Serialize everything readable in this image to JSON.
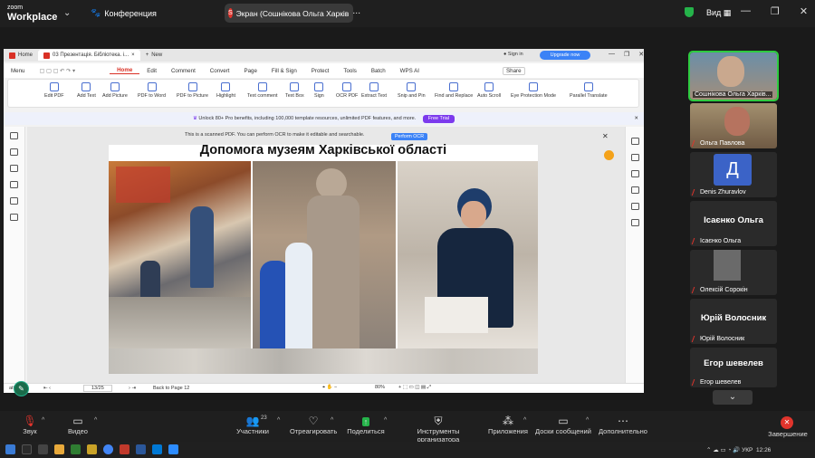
{
  "zoom": {
    "logo_line1": "zoom",
    "logo_line2": "Workplace",
    "conference_label": "Конференция",
    "share_title": "Экран (Сошнікова Ольга Харків",
    "view_label": "Вид"
  },
  "browser": {
    "tab_home": "Home",
    "tab_doc": "03 Презентація. Бібліотека. i...",
    "new_tab": "New",
    "signin": "Sign in",
    "upgrade": "Upgrade now"
  },
  "menu": {
    "items": [
      "Menu",
      "Home",
      "Edit",
      "Comment",
      "Convert",
      "Page",
      "Fill & Sign",
      "Protect",
      "Tools",
      "Batch",
      "WPS AI"
    ],
    "share": "Share"
  },
  "toolbar": {
    "tools": [
      "Edit PDF",
      "Add Text",
      "Add Picture",
      "PDF to Word",
      "PDF to Picture",
      "Highlight",
      "Text comment",
      "Text Box",
      "Sign",
      "OCR PDF",
      "Extract Text",
      "Snip and Pin",
      "Find and Replace",
      "Auto Scroll",
      "Eye Protection Mode",
      "Parallel Translate"
    ]
  },
  "banner": {
    "text": "Unlock 80+ Pro benefits, including 100,000 template resources, unlimited PDF features, and more.",
    "button": "Free Trial"
  },
  "scanned": {
    "text": "This is a scanned PDF. You can perform OCR to make it editable and searchable.",
    "button": "Perform OCR"
  },
  "slide": {
    "title": "Допомога музеям Харківської області"
  },
  "status": {
    "page": "13/25",
    "back": "Back to Page 12",
    "zoom": "80%",
    "navigation": "ation"
  },
  "participants": [
    {
      "name": "Сошнікова Ольга Харків..."
    },
    {
      "name": "Ольга Павлова"
    },
    {
      "name": "Denis Zhuravlov",
      "initial": "Д"
    },
    {
      "name": "Ісаєнко Ольга",
      "big": "Ісаєнко Ольга"
    },
    {
      "name": "Олексій Сорокін"
    },
    {
      "name": "Юрій Волосник",
      "big": "Юрій Волосник"
    },
    {
      "name": "Егор шевелев",
      "big": "Егор шевелев"
    }
  ],
  "bottom": {
    "sound": "Звук",
    "video": "Видео",
    "participants": "Участники",
    "participants_count": "23",
    "react": "Отреагировать",
    "share": "Поделиться",
    "host_tools": "Инструменты организатора",
    "apps": "Приложения",
    "boards": "Доски сообщений",
    "more": "Дополнительно",
    "end": "Завершение"
  },
  "tray": {
    "lang": "УКР",
    "time": "12:26"
  }
}
